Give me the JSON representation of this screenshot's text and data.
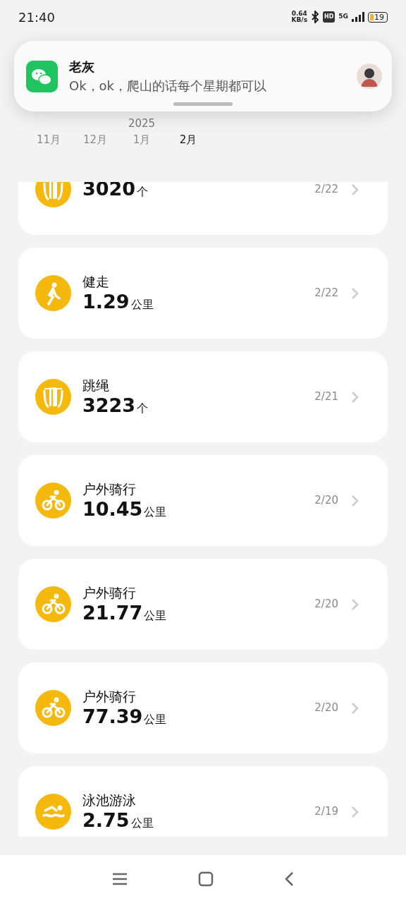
{
  "status_bar": {
    "time": "21:40",
    "net_speed_value": "0.64",
    "net_speed_unit": "KB/s",
    "hd": "HD",
    "network": "5G",
    "battery": "19"
  },
  "notification": {
    "sender": "老灰",
    "message": "Ok，ok，爬山的话每个星期都可以"
  },
  "months": [
    {
      "label": "11月",
      "selected": false
    },
    {
      "label": "12月",
      "selected": false
    },
    {
      "label": "1月",
      "year": "2025",
      "selected": false
    },
    {
      "label": "2月",
      "selected": true
    }
  ],
  "records": [
    {
      "kind": "jump",
      "value": "3020",
      "unit": "个",
      "date": "2/22"
    },
    {
      "kind": "walk",
      "name": "健走",
      "value": "1.29",
      "unit": "公里",
      "date": "2/22"
    },
    {
      "kind": "jump",
      "name": "跳绳",
      "value": "3223",
      "unit": "个",
      "date": "2/21"
    },
    {
      "kind": "bike",
      "name": "户外骑行",
      "value": "10.45",
      "unit": "公里",
      "date": "2/20"
    },
    {
      "kind": "bike",
      "name": "户外骑行",
      "value": "21.77",
      "unit": "公里",
      "date": "2/20"
    },
    {
      "kind": "bike",
      "name": "户外骑行",
      "value": "77.39",
      "unit": "公里",
      "date": "2/20"
    },
    {
      "kind": "swim",
      "name": "泳池游泳",
      "value": "2.75",
      "unit": "公里",
      "date": "2/19"
    }
  ]
}
